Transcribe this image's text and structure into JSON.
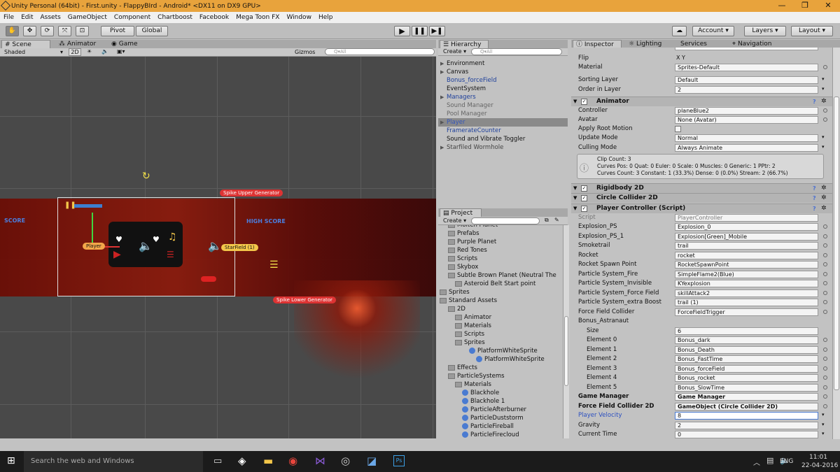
{
  "window": {
    "title": "Unity Personal (64bit) - First.unity - FlappyBIrd - Android* <DX11 on DX9 GPU>",
    "min": "—",
    "max": "❐",
    "close": "✕"
  },
  "menu": [
    "File",
    "Edit",
    "Assets",
    "GameObject",
    "Component",
    "Chartboost",
    "Facebook",
    "Mega Toon FX",
    "Window",
    "Help"
  ],
  "toolbar": {
    "pivot": "Pivot",
    "global": "Global",
    "account": "Account",
    "layers": "Layers",
    "layout": "Layout"
  },
  "scene": {
    "tabs": [
      "Scene",
      "Animator",
      "Game"
    ],
    "shaded": "Shaded",
    "mode2d": "2D",
    "gizmos": "Gizmos",
    "search": "Q▾All",
    "labels": {
      "score": "SCORE",
      "highscore": "HIGH SCORE",
      "spike_upper": "Spike Upper Generator",
      "spike_lower": "Spike Lower Generator",
      "starfield": "StarField (1)",
      "player": "Player"
    }
  },
  "hierarchy": {
    "tab": "Hierarchy",
    "create": "Create",
    "search": "Q▾All",
    "items": [
      {
        "t": "Environment",
        "c": "#111",
        "arrow": "▶"
      },
      {
        "t": "Canvas",
        "c": "#111",
        "arrow": "▶"
      },
      {
        "t": "Bonus_forceField",
        "c": "#1d3f9b",
        "arrow": ""
      },
      {
        "t": "EventSystem",
        "c": "#111",
        "arrow": ""
      },
      {
        "t": "Managers",
        "c": "#1d3f9b",
        "arrow": "▶"
      },
      {
        "t": "Sound Manager",
        "c": "#666",
        "arrow": ""
      },
      {
        "t": "Pool Manager",
        "c": "#666",
        "arrow": ""
      },
      {
        "t": "Player",
        "c": "#3355bb",
        "arrow": "▶"
      },
      {
        "t": "FramerateCounter",
        "c": "#1d3f9b",
        "arrow": ""
      },
      {
        "t": "Sound and Vibrate Toggler",
        "c": "#111",
        "arrow": ""
      },
      {
        "t": "Starfiled Wormhole",
        "c": "#444",
        "arrow": "▶"
      }
    ]
  },
  "project": {
    "tab": "Project",
    "create": "Create",
    "items": [
      {
        "t": "Molten Planet",
        "i": 12
      },
      {
        "t": "Prefabs",
        "i": 12
      },
      {
        "t": "Purple Planet",
        "i": 12
      },
      {
        "t": "Red Tones",
        "i": 12
      },
      {
        "t": "Scripts",
        "i": 12
      },
      {
        "t": "Skybox",
        "i": 12
      },
      {
        "t": "Subtle Brown Planet (Neutral The",
        "i": 12
      },
      {
        "t": "Asteroid Belt Start point",
        "i": 22
      },
      {
        "t": "Sprites",
        "i": 0
      },
      {
        "t": "Standard Assets",
        "i": 0
      },
      {
        "t": "2D",
        "i": 12
      },
      {
        "t": "Animator",
        "i": 22
      },
      {
        "t": "Materials",
        "i": 22
      },
      {
        "t": "Scripts",
        "i": 22
      },
      {
        "t": "Sprites",
        "i": 22
      },
      {
        "t": "PlatformWhiteSprite",
        "i": 42
      },
      {
        "t": "PlatformWhiteSprite",
        "i": 52
      },
      {
        "t": "Effects",
        "i": 12
      },
      {
        "t": "ParticleSystems",
        "i": 12
      },
      {
        "t": "Materials",
        "i": 22
      },
      {
        "t": "Blackhole",
        "i": 32
      },
      {
        "t": "Blackhole 1",
        "i": 32
      },
      {
        "t": "ParticleAfterburner",
        "i": 32
      },
      {
        "t": "ParticleDuststorm",
        "i": 32
      },
      {
        "t": "ParticleFireball",
        "i": 32
      },
      {
        "t": "ParticleFirecloud",
        "i": 32
      }
    ]
  },
  "inspector": {
    "tabs": [
      "Inspector",
      "Lighting",
      "Services",
      "Navigation"
    ],
    "top": [
      {
        "l": "Flip",
        "v": "X  Y"
      },
      {
        "l": "Material",
        "v": "Sprites-Default"
      },
      {
        "l": "Sorting Layer",
        "v": "Default"
      },
      {
        "l": "Order in Layer",
        "v": "2"
      }
    ],
    "animator": {
      "title": "Animator",
      "rows": [
        {
          "l": "Controller",
          "v": "planeBlue2"
        },
        {
          "l": "Avatar",
          "v": "None (Avatar)"
        },
        {
          "l": "Apply Root Motion",
          "v": ""
        },
        {
          "l": "Update Mode",
          "v": "Normal"
        },
        {
          "l": "Culling Mode",
          "v": "Always Animate"
        }
      ],
      "info": [
        "Clip Count: 3",
        "Curves Pos: 0 Quat: 0 Euler: 0 Scale: 0 Muscles: 0 Generic: 1 PPtr: 2",
        "Curves Count: 3 Constant: 1 (33.3%) Dense: 0 (0.0%) Stream: 2 (66.7%)"
      ]
    },
    "components": [
      "Rigidbody 2D",
      "Circle Collider 2D",
      "Player Controller (Script)"
    ],
    "script": {
      "l": "Script",
      "v": "PlayerController"
    },
    "fields": [
      {
        "l": "Explosion_PS",
        "v": "Explosion_0"
      },
      {
        "l": "Explosion_PS_1",
        "v": "Explosion[Green]_Mobile"
      },
      {
        "l": "Smoketrail",
        "v": "trail"
      },
      {
        "l": "Rocket",
        "v": "rocket"
      },
      {
        "l": "Rocket Spawn Point",
        "v": "RocketSpawnPoint"
      },
      {
        "l": "Particle System_Fire",
        "v": "SimpleFlame2(Blue)"
      },
      {
        "l": "Particle System_Invisible",
        "v": "KYexplosion"
      },
      {
        "l": "Particle System_Force Field",
        "v": "skillAttack2"
      },
      {
        "l": "Particle System_extra Boost",
        "v": "trail (1)"
      },
      {
        "l": "Force Field Collider",
        "v": "ForceFieldTrigger"
      }
    ],
    "bonus": {
      "l": "Bonus_Astranaut",
      "size_l": "Size",
      "size": "6",
      "elements": [
        {
          "l": "Element 0",
          "v": "Bonus_dark"
        },
        {
          "l": "Element 1",
          "v": "Bonus_Death"
        },
        {
          "l": "Element 2",
          "v": "Bonus_FastTime"
        },
        {
          "l": "Element 3",
          "v": "Bonus_forceField"
        },
        {
          "l": "Element 4",
          "v": "Bonus_rocket"
        },
        {
          "l": "Element 5",
          "v": "Bonus_SlowTime"
        }
      ]
    },
    "tail": [
      {
        "l": "Game Manager",
        "v": "Game Manager",
        "b": true
      },
      {
        "l": "Force Field Collider 2D",
        "v": "GameObject (Circle Collider 2D)",
        "b": true
      },
      {
        "l": "Player Velocity",
        "v": "8",
        "blue": true
      },
      {
        "l": "Gravity",
        "v": "2"
      },
      {
        "l": "Current Time",
        "v": "0"
      }
    ]
  },
  "taskbar": {
    "search": "Search the web and Windows",
    "lang": "ENG",
    "time": "11:01",
    "date": "22-04-2016"
  }
}
